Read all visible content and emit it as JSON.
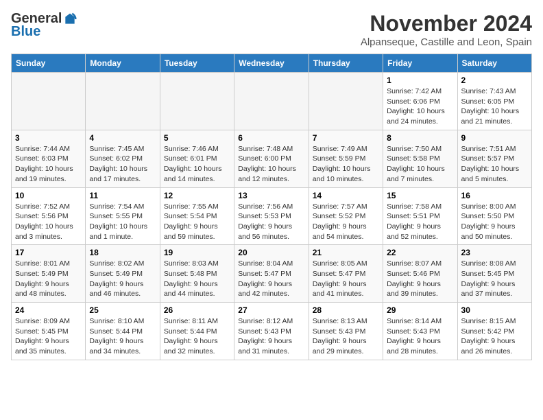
{
  "logo": {
    "general": "General",
    "blue": "Blue"
  },
  "title": "November 2024",
  "subtitle": "Alpanseque, Castille and Leon, Spain",
  "days_header": [
    "Sunday",
    "Monday",
    "Tuesday",
    "Wednesday",
    "Thursday",
    "Friday",
    "Saturday"
  ],
  "weeks": [
    [
      {
        "day": "",
        "info": ""
      },
      {
        "day": "",
        "info": ""
      },
      {
        "day": "",
        "info": ""
      },
      {
        "day": "",
        "info": ""
      },
      {
        "day": "",
        "info": ""
      },
      {
        "day": "1",
        "info": "Sunrise: 7:42 AM\nSunset: 6:06 PM\nDaylight: 10 hours\nand 24 minutes."
      },
      {
        "day": "2",
        "info": "Sunrise: 7:43 AM\nSunset: 6:05 PM\nDaylight: 10 hours\nand 21 minutes."
      }
    ],
    [
      {
        "day": "3",
        "info": "Sunrise: 7:44 AM\nSunset: 6:03 PM\nDaylight: 10 hours\nand 19 minutes."
      },
      {
        "day": "4",
        "info": "Sunrise: 7:45 AM\nSunset: 6:02 PM\nDaylight: 10 hours\nand 17 minutes."
      },
      {
        "day": "5",
        "info": "Sunrise: 7:46 AM\nSunset: 6:01 PM\nDaylight: 10 hours\nand 14 minutes."
      },
      {
        "day": "6",
        "info": "Sunrise: 7:48 AM\nSunset: 6:00 PM\nDaylight: 10 hours\nand 12 minutes."
      },
      {
        "day": "7",
        "info": "Sunrise: 7:49 AM\nSunset: 5:59 PM\nDaylight: 10 hours\nand 10 minutes."
      },
      {
        "day": "8",
        "info": "Sunrise: 7:50 AM\nSunset: 5:58 PM\nDaylight: 10 hours\nand 7 minutes."
      },
      {
        "day": "9",
        "info": "Sunrise: 7:51 AM\nSunset: 5:57 PM\nDaylight: 10 hours\nand 5 minutes."
      }
    ],
    [
      {
        "day": "10",
        "info": "Sunrise: 7:52 AM\nSunset: 5:56 PM\nDaylight: 10 hours\nand 3 minutes."
      },
      {
        "day": "11",
        "info": "Sunrise: 7:54 AM\nSunset: 5:55 PM\nDaylight: 10 hours\nand 1 minute."
      },
      {
        "day": "12",
        "info": "Sunrise: 7:55 AM\nSunset: 5:54 PM\nDaylight: 9 hours\nand 59 minutes."
      },
      {
        "day": "13",
        "info": "Sunrise: 7:56 AM\nSunset: 5:53 PM\nDaylight: 9 hours\nand 56 minutes."
      },
      {
        "day": "14",
        "info": "Sunrise: 7:57 AM\nSunset: 5:52 PM\nDaylight: 9 hours\nand 54 minutes."
      },
      {
        "day": "15",
        "info": "Sunrise: 7:58 AM\nSunset: 5:51 PM\nDaylight: 9 hours\nand 52 minutes."
      },
      {
        "day": "16",
        "info": "Sunrise: 8:00 AM\nSunset: 5:50 PM\nDaylight: 9 hours\nand 50 minutes."
      }
    ],
    [
      {
        "day": "17",
        "info": "Sunrise: 8:01 AM\nSunset: 5:49 PM\nDaylight: 9 hours\nand 48 minutes."
      },
      {
        "day": "18",
        "info": "Sunrise: 8:02 AM\nSunset: 5:49 PM\nDaylight: 9 hours\nand 46 minutes."
      },
      {
        "day": "19",
        "info": "Sunrise: 8:03 AM\nSunset: 5:48 PM\nDaylight: 9 hours\nand 44 minutes."
      },
      {
        "day": "20",
        "info": "Sunrise: 8:04 AM\nSunset: 5:47 PM\nDaylight: 9 hours\nand 42 minutes."
      },
      {
        "day": "21",
        "info": "Sunrise: 8:05 AM\nSunset: 5:47 PM\nDaylight: 9 hours\nand 41 minutes."
      },
      {
        "day": "22",
        "info": "Sunrise: 8:07 AM\nSunset: 5:46 PM\nDaylight: 9 hours\nand 39 minutes."
      },
      {
        "day": "23",
        "info": "Sunrise: 8:08 AM\nSunset: 5:45 PM\nDaylight: 9 hours\nand 37 minutes."
      }
    ],
    [
      {
        "day": "24",
        "info": "Sunrise: 8:09 AM\nSunset: 5:45 PM\nDaylight: 9 hours\nand 35 minutes."
      },
      {
        "day": "25",
        "info": "Sunrise: 8:10 AM\nSunset: 5:44 PM\nDaylight: 9 hours\nand 34 minutes."
      },
      {
        "day": "26",
        "info": "Sunrise: 8:11 AM\nSunset: 5:44 PM\nDaylight: 9 hours\nand 32 minutes."
      },
      {
        "day": "27",
        "info": "Sunrise: 8:12 AM\nSunset: 5:43 PM\nDaylight: 9 hours\nand 31 minutes."
      },
      {
        "day": "28",
        "info": "Sunrise: 8:13 AM\nSunset: 5:43 PM\nDaylight: 9 hours\nand 29 minutes."
      },
      {
        "day": "29",
        "info": "Sunrise: 8:14 AM\nSunset: 5:43 PM\nDaylight: 9 hours\nand 28 minutes."
      },
      {
        "day": "30",
        "info": "Sunrise: 8:15 AM\nSunset: 5:42 PM\nDaylight: 9 hours\nand 26 minutes."
      }
    ]
  ]
}
